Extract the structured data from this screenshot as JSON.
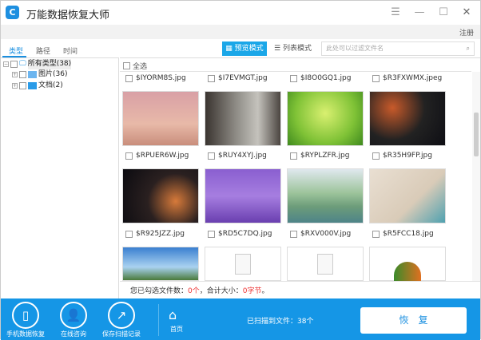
{
  "window": {
    "title": "万能数据恢复大师",
    "register": "注册"
  },
  "tabs": [
    {
      "label": "类型"
    },
    {
      "label": "路径"
    },
    {
      "label": "时间"
    }
  ],
  "tree": [
    {
      "label": "所有类型(38)"
    },
    {
      "label": "图片(36)"
    },
    {
      "label": "文档(2)"
    }
  ],
  "view": {
    "preview_label": "预览模式",
    "list_label": "列表模式",
    "search_placeholder": "此处可以过滤文件名",
    "select_all": "全选"
  },
  "files": [
    {
      "name": "$IYORM8S.jpg",
      "thumb": "eiffel"
    },
    {
      "name": "$I7EVMGT.jpg",
      "thumb": "room"
    },
    {
      "name": "$I8O0GQ1.jpg",
      "thumb": "sprout"
    },
    {
      "name": "$R3FXWMX.jpeg",
      "thumb": "camera"
    },
    {
      "name": "$RPUER6W.jpg",
      "thumb": "camera-text"
    },
    {
      "name": "$RUY4XYJ.jpg",
      "thumb": "lavender"
    },
    {
      "name": "$RYPLZFR.jpg",
      "thumb": "river"
    },
    {
      "name": "$R35H9FP.jpg",
      "thumb": "beach-heart"
    },
    {
      "name": "$R925JZZ.jpg",
      "thumb": "sky"
    },
    {
      "name": "$RD5C7DQ.jpg",
      "thumb": "document"
    },
    {
      "name": "$RXV000V.jpg",
      "thumb": "document"
    },
    {
      "name": "$R5FCC18.jpg",
      "thumb": "logo"
    }
  ],
  "status": {
    "prefix": "您已勾选文件数：",
    "count": "0个",
    "mid": "，合计大小：",
    "size": "0字节",
    "end": "。"
  },
  "bottom": {
    "phone_recovery": "手机数据恢复",
    "online_consult": "在线咨询",
    "save_scan": "保存扫描记录",
    "home": "首页",
    "scanned": "已扫描到文件：38个",
    "recover": "恢复"
  },
  "colors": {
    "accent": "#1596e6",
    "highlight": "#e33333"
  }
}
